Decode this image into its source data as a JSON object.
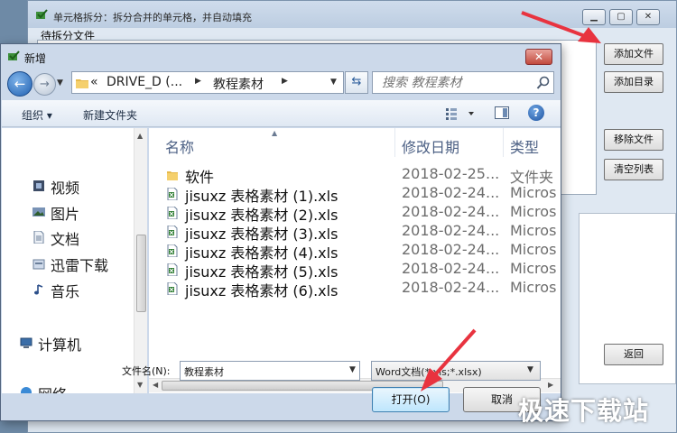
{
  "background_window": {
    "title": "单元格拆分：拆分合并的单元格，并自动填充",
    "group_label": "待拆分文件",
    "buttons": {
      "add_file": "添加文件",
      "add_dir": "添加目录",
      "remove_file": "移除文件",
      "clear_list": "清空列表",
      "back": "返回"
    }
  },
  "dialog": {
    "title": "新增",
    "close_glyph": "✕",
    "address": {
      "overflow": "«",
      "segment1": "DRIVE_D (...",
      "segment2": "教程素材"
    },
    "search_placeholder": "搜索 教程素材",
    "toolbar": {
      "organize": "组织 ▾",
      "new_folder": "新建文件夹"
    },
    "nav_items": [
      {
        "label": "视频",
        "icon": "video-icon"
      },
      {
        "label": "图片",
        "icon": "picture-icon"
      },
      {
        "label": "文档",
        "icon": "document-icon"
      },
      {
        "label": "迅雷下载",
        "icon": "download-folder-icon"
      },
      {
        "label": "音乐",
        "icon": "music-icon"
      },
      {
        "label": "计算机",
        "icon": "computer-icon"
      },
      {
        "label": "网络",
        "icon": "network-icon"
      }
    ],
    "columns": {
      "name": "名称",
      "date": "修改日期",
      "type": "类型"
    },
    "files": [
      {
        "name": "软件",
        "date": "2018-02-25...",
        "type": "文件夹",
        "icon": "folder-icon"
      },
      {
        "name": "jisuxz 表格素材 (1).xls",
        "date": "2018-02-24...",
        "type": "Micros",
        "icon": "excel-file-icon"
      },
      {
        "name": "jisuxz 表格素材 (2).xls",
        "date": "2018-02-24...",
        "type": "Micros",
        "icon": "excel-file-icon"
      },
      {
        "name": "jisuxz 表格素材 (3).xls",
        "date": "2018-02-24...",
        "type": "Micros",
        "icon": "excel-file-icon"
      },
      {
        "name": "jisuxz 表格素材 (4).xls",
        "date": "2018-02-24...",
        "type": "Micros",
        "icon": "excel-file-icon"
      },
      {
        "name": "jisuxz 表格素材 (5).xls",
        "date": "2018-02-24...",
        "type": "Micros",
        "icon": "excel-file-icon"
      },
      {
        "name": "jisuxz 表格素材 (6).xls",
        "date": "2018-02-24...",
        "type": "Micros",
        "icon": "excel-file-icon"
      }
    ],
    "filename_label": "文件名(N):",
    "filename_value": "教程素材",
    "filetype_value": "Word文档(*.xls;*.xlsx)",
    "open_label": "打开(O)",
    "cancel_label": "取消"
  },
  "watermark": "极速下载站",
  "colors": {
    "accent_arrow": "#e8333f",
    "open_button": "#bee6fd"
  }
}
